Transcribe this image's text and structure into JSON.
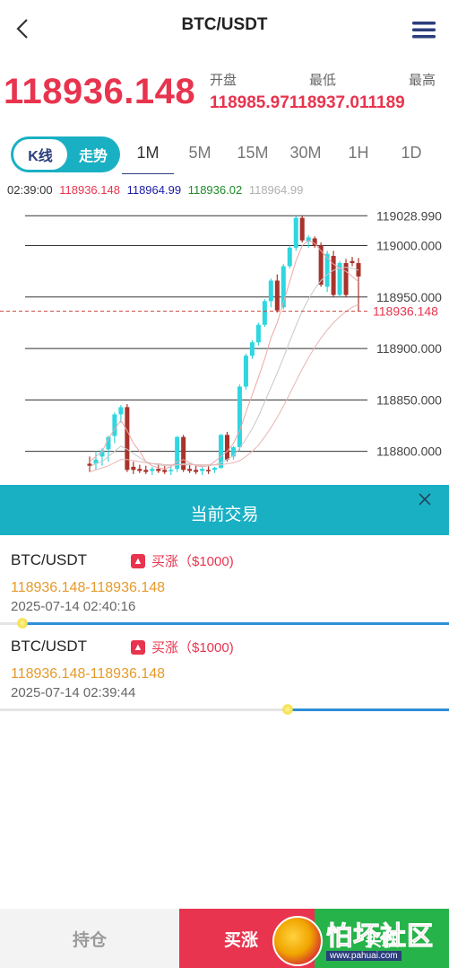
{
  "header": {
    "title": "BTC/USDT",
    "back_icon": "chevron-left-icon",
    "menu_icon": "menu-icon"
  },
  "quote": {
    "last_price": "118936.148",
    "labels": {
      "open": "开盘",
      "low": "最低",
      "high": "最高"
    },
    "values_text": "118985.97118937.011189"
  },
  "tabs": {
    "kline": "K线",
    "trend": "走势",
    "intervals": [
      "1M",
      "5M",
      "15M",
      "30M",
      "1H",
      "1D"
    ],
    "selected_interval": "1M"
  },
  "ohlc_bar": {
    "time": "02:39:00",
    "v1": "118936.148",
    "v2": "118964.99",
    "v3": "118936.02",
    "v4": "118964.99",
    "colors": {
      "v1": "#e8344e",
      "v2": "#1a1aa8",
      "v3": "#1e8a2a",
      "v4": "#b0b0b0"
    }
  },
  "chart_data": {
    "type": "candlestick",
    "ytick_labels": [
      "119028.990",
      "119000.000",
      "118950.000",
      "118900.000",
      "118850.000",
      "118800.000"
    ],
    "yticks": [
      119028.99,
      119000,
      118950,
      118900,
      118850,
      118800
    ],
    "current_price": 118936.148,
    "current_price_label": "118936.148",
    "ylim": [
      118784,
      119031
    ],
    "candles": [
      {
        "o": 118788,
        "h": 118795,
        "l": 118780,
        "c": 118786
      },
      {
        "o": 118788,
        "h": 118800,
        "l": 118782,
        "c": 118792
      },
      {
        "o": 118795,
        "h": 118803,
        "l": 118786,
        "c": 118801
      },
      {
        "o": 118802,
        "h": 118815,
        "l": 118790,
        "c": 118814
      },
      {
        "o": 118815,
        "h": 118838,
        "l": 118808,
        "c": 118836
      },
      {
        "o": 118836,
        "h": 118845,
        "l": 118828,
        "c": 118843
      },
      {
        "o": 118843,
        "h": 118846,
        "l": 118780,
        "c": 118782
      },
      {
        "o": 118785,
        "h": 118790,
        "l": 118778,
        "c": 118782
      },
      {
        "o": 118783,
        "h": 118787,
        "l": 118779,
        "c": 118781
      },
      {
        "o": 118782,
        "h": 118786,
        "l": 118778,
        "c": 118780
      },
      {
        "o": 118781,
        "h": 118785,
        "l": 118777,
        "c": 118783
      },
      {
        "o": 118783,
        "h": 118788,
        "l": 118779,
        "c": 118781
      },
      {
        "o": 118782,
        "h": 118786,
        "l": 118778,
        "c": 118780
      },
      {
        "o": 118781,
        "h": 118785,
        "l": 118777,
        "c": 118782
      },
      {
        "o": 118783,
        "h": 118815,
        "l": 118780,
        "c": 118814
      },
      {
        "o": 118814,
        "h": 118816,
        "l": 118780,
        "c": 118782
      },
      {
        "o": 118783,
        "h": 118787,
        "l": 118779,
        "c": 118781
      },
      {
        "o": 118782,
        "h": 118786,
        "l": 118778,
        "c": 118780
      },
      {
        "o": 118781,
        "h": 118785,
        "l": 118777,
        "c": 118783
      },
      {
        "o": 118782,
        "h": 118786,
        "l": 118778,
        "c": 118781
      },
      {
        "o": 118782,
        "h": 118785,
        "l": 118779,
        "c": 118784
      },
      {
        "o": 118784,
        "h": 118817,
        "l": 118783,
        "c": 118816
      },
      {
        "o": 118816,
        "h": 118819,
        "l": 118790,
        "c": 118792
      },
      {
        "o": 118795,
        "h": 118805,
        "l": 118792,
        "c": 118804
      },
      {
        "o": 118804,
        "h": 118865,
        "l": 118800,
        "c": 118863
      },
      {
        "o": 118863,
        "h": 118895,
        "l": 118860,
        "c": 118893
      },
      {
        "o": 118893,
        "h": 118908,
        "l": 118890,
        "c": 118906
      },
      {
        "o": 118906,
        "h": 118925,
        "l": 118903,
        "c": 118923
      },
      {
        "o": 118923,
        "h": 118948,
        "l": 118921,
        "c": 118946
      },
      {
        "o": 118946,
        "h": 118968,
        "l": 118940,
        "c": 118966
      },
      {
        "o": 118966,
        "h": 118972,
        "l": 118935,
        "c": 118937
      },
      {
        "o": 118940,
        "h": 118982,
        "l": 118938,
        "c": 118980
      },
      {
        "o": 118980,
        "h": 119000,
        "l": 118978,
        "c": 118998
      },
      {
        "o": 118998,
        "h": 119029,
        "l": 118995,
        "c": 119027
      },
      {
        "o": 119027,
        "h": 119029,
        "l": 119003,
        "c": 119005
      },
      {
        "o": 119004,
        "h": 119010,
        "l": 118998,
        "c": 119008
      },
      {
        "o": 119007,
        "h": 119009,
        "l": 118998,
        "c": 119000
      },
      {
        "o": 119000,
        "h": 119003,
        "l": 118960,
        "c": 118962
      },
      {
        "o": 118960,
        "h": 118995,
        "l": 118955,
        "c": 118992
      },
      {
        "o": 118990,
        "h": 118995,
        "l": 118950,
        "c": 118952
      },
      {
        "o": 118952,
        "h": 118985,
        "l": 118950,
        "c": 118983
      },
      {
        "o": 118983,
        "h": 118987,
        "l": 118950,
        "c": 118952
      },
      {
        "o": 118985,
        "h": 118989,
        "l": 118980,
        "c": 118983
      },
      {
        "o": 118983,
        "h": 118988,
        "l": 118936,
        "c": 118970
      }
    ],
    "moving_averages": [
      {
        "color": "#f0a5a5",
        "values": [
          118790,
          118795,
          118800,
          118812,
          118822,
          118830,
          118820,
          118808,
          118800,
          118790,
          118786,
          118784,
          118783,
          118785,
          118790,
          118792,
          118789,
          118786,
          118785,
          118786,
          118790,
          118795,
          118800,
          118808,
          118820,
          118838,
          118855,
          118872,
          118890,
          118910,
          118925,
          118945,
          118965,
          118985,
          119000,
          119005,
          119002,
          118995,
          118988,
          118982,
          118978,
          118975,
          118970,
          118965
        ]
      },
      {
        "color": "#c8c8c8",
        "values": [
          118785,
          118788,
          118790,
          118795,
          118800,
          118805,
          118802,
          118798,
          118794,
          118790,
          118788,
          118787,
          118786,
          118786,
          118787,
          118788,
          118788,
          118787,
          118786,
          118786,
          118787,
          118789,
          118792,
          118796,
          118803,
          118812,
          118822,
          118834,
          118848,
          118862,
          118876,
          118891,
          118907,
          118922,
          118936,
          118948,
          118958,
          118966,
          118972,
          118976,
          118978,
          118979,
          118978,
          118976
        ]
      },
      {
        "color": "#e8b4b4",
        "values": [
          118780,
          118782,
          118784,
          118786,
          118789,
          118792,
          118792,
          118791,
          118790,
          118789,
          118788,
          118788,
          118787,
          118787,
          118787,
          118787,
          118787,
          118787,
          118787,
          118787,
          118787,
          118787,
          118788,
          118789,
          118791,
          118795,
          118800,
          118806,
          118814,
          118823,
          118833,
          118844,
          118856,
          118868,
          118880,
          118891,
          118901,
          118910,
          118918,
          118925,
          118931,
          118936,
          118940,
          118943
        ]
      }
    ]
  },
  "trades_panel": {
    "title": "当前交易",
    "close_icon": "close-icon",
    "trades": [
      {
        "symbol": "BTC/USDT",
        "direction": "买涨（$1000)",
        "range": "118936.148-118936.148",
        "time": "2025-07-14 02:40:16",
        "progress": 0.95
      },
      {
        "symbol": "BTC/USDT",
        "direction": "买涨（$1000)",
        "range": "118936.148-118936.148",
        "time": "2025-07-14 02:39:44",
        "progress": 0.36
      }
    ]
  },
  "bottom_bar": {
    "positions": "持仓",
    "buy_up": "买涨",
    "buy_down": "买跌"
  },
  "watermark": {
    "text": "怕坏社区",
    "url": "www.pahuai.com"
  }
}
